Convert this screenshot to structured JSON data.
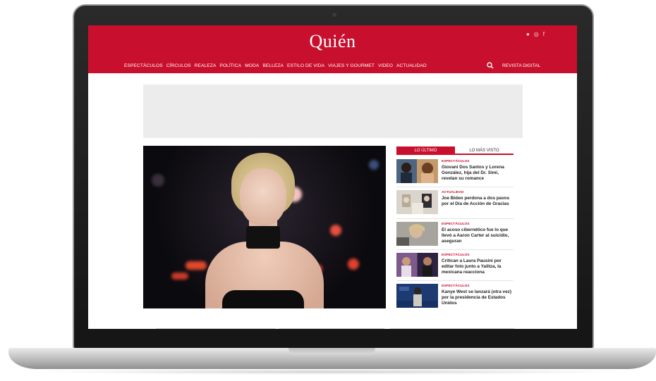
{
  "site": {
    "logo": "Quién",
    "nav_items": [
      "ESPECTÁCULOS",
      "CÍRCULOS",
      "REALEZA",
      "POLÍTICA",
      "MODA",
      "BELLEZA",
      "ESTILO DE VIDA",
      "VIAJES Y GOURMET",
      "VIDEO",
      "ACTUALIDAD"
    ],
    "revista_label": "REVISTA DIGITAL",
    "brand_color": "#c8102e"
  },
  "sidebar": {
    "tabs": [
      "LO ÚLTIMO",
      "LO MÁS VISTO"
    ],
    "active_tab": 0,
    "items": [
      {
        "category": "ESPECTÁCULOS",
        "headline": "Giovani Dos Santos y Lorena González, hija del Dr. Simi, revelan su romance"
      },
      {
        "category": "ACTUALIDAD",
        "headline": "Joe Biden perdona a dos pavos por el Día de Acción de Gracias"
      },
      {
        "category": "ESPECTÁCULOS",
        "headline": "El acoso cibernético fue lo que llevó a Aaron Carter al suicidio, aseguran"
      },
      {
        "category": "ESPECTÁCULOS",
        "headline": "Critican a Laura Pausini por editar foto junto a Yalitza, la mexicana reacciona"
      },
      {
        "category": "ESPECTÁCULOS",
        "headline": "Kanye West se lanzará (otra vez) por la presidencia de Estados Unidos"
      }
    ]
  }
}
